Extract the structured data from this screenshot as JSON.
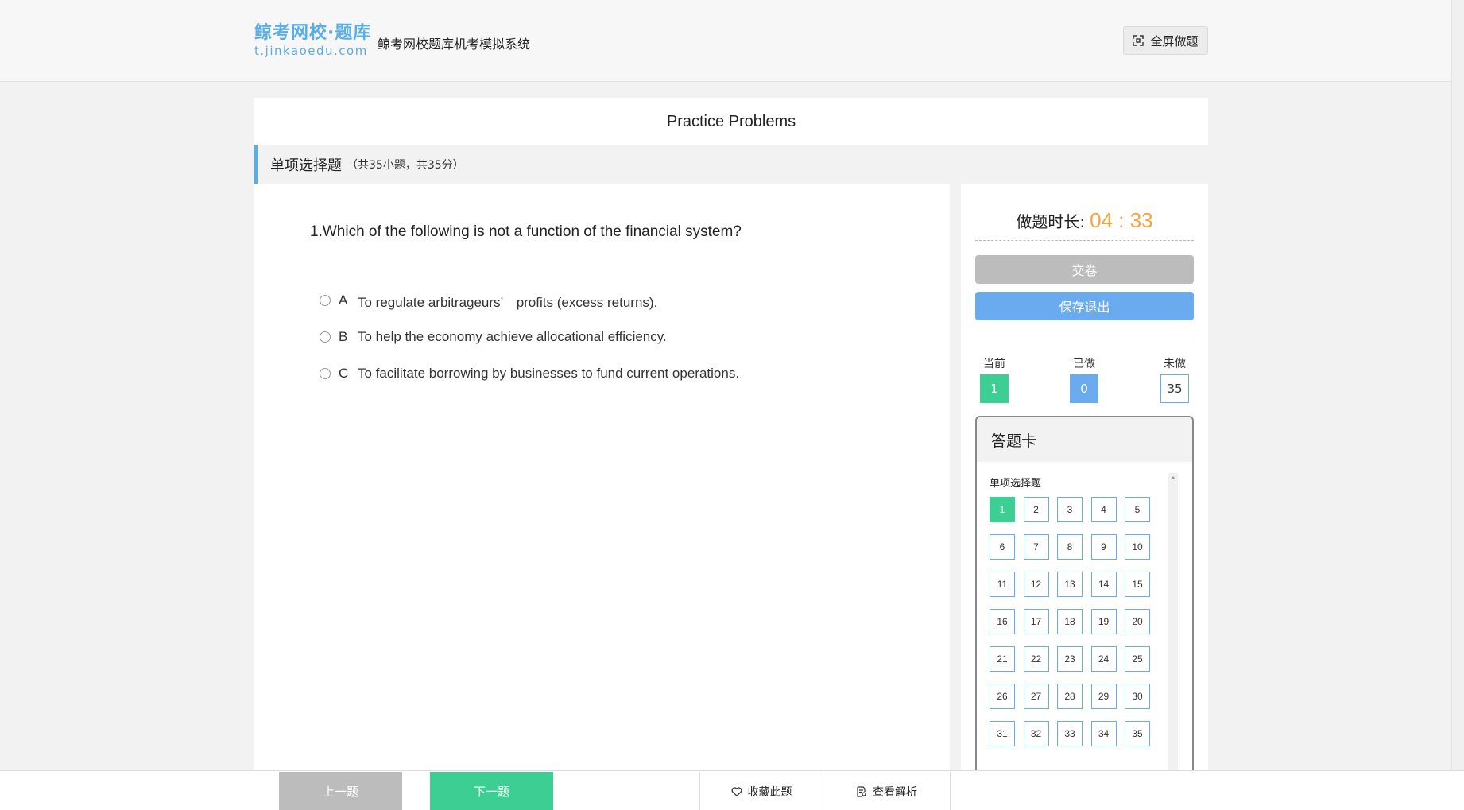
{
  "header": {
    "logo_cn": "鲸考网校·题库",
    "logo_url": "t.jinkaoedu.com",
    "site_title": "鲸考网校题库机考模拟系统",
    "fullscreen_label": "全屏做题"
  },
  "exam": {
    "title": "Practice Problems"
  },
  "section": {
    "name": "单项选择题",
    "meta": "（共35小题，共35分）"
  },
  "question": {
    "text": "1.Which of the following is not a function of the financial system?",
    "options": [
      {
        "letter": "A",
        "text": "To regulate arbitrageurs’　profits (excess returns)."
      },
      {
        "letter": "B",
        "text": "To help the economy achieve allocational efficiency."
      },
      {
        "letter": "C",
        "text": "To facilitate borrowing by businesses to fund current operations."
      }
    ]
  },
  "side": {
    "timer_label": "做题时长:",
    "timer_value": "04 : 33",
    "submit_label": "交卷",
    "save_label": "保存退出",
    "stats": {
      "current_label": "当前",
      "current_value": "1",
      "done_label": "已做",
      "done_value": "0",
      "todo_label": "未做",
      "todo_value": "35"
    },
    "card": {
      "title": "答题卡",
      "section_label": "单项选择题",
      "current_index": 1,
      "numbers": [
        "1",
        "2",
        "3",
        "4",
        "5",
        "6",
        "7",
        "8",
        "9",
        "10",
        "11",
        "12",
        "13",
        "14",
        "15",
        "16",
        "17",
        "18",
        "19",
        "20",
        "21",
        "22",
        "23",
        "24",
        "25",
        "26",
        "27",
        "28",
        "29",
        "30",
        "31",
        "32",
        "33",
        "34",
        "35"
      ]
    }
  },
  "footer": {
    "prev_label": "上一题",
    "next_label": "下一题",
    "favorite_label": "收藏此题",
    "analysis_label": "查看解析"
  },
  "colors": {
    "brand_blue": "#5aaee8",
    "button_blue": "#6aabf0",
    "current_green": "#3dce94",
    "timer_orange": "#f5a53a",
    "disabled_gray": "#bcbcbc"
  },
  "icons": {
    "fullscreen": "fullscreen-icon",
    "favorite": "heart-icon",
    "analysis": "document-search-icon"
  }
}
